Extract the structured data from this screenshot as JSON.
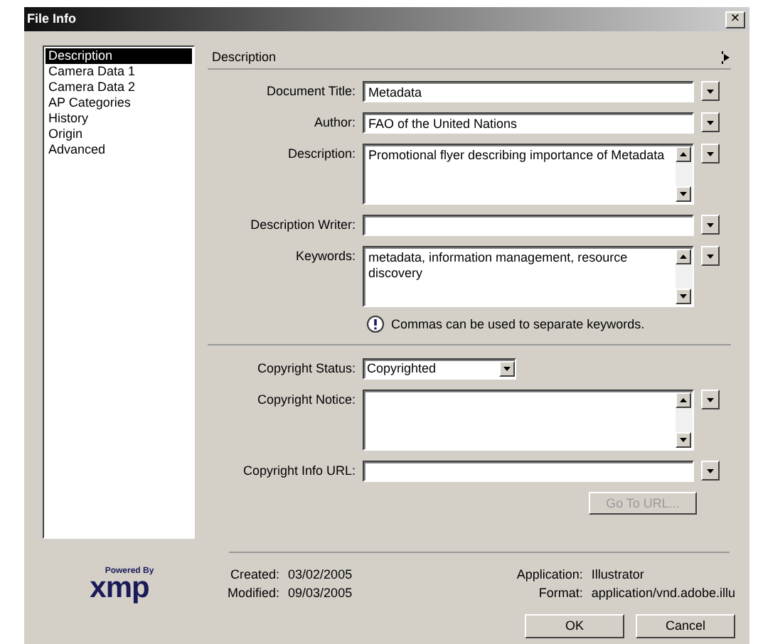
{
  "window": {
    "title": "File Info",
    "close": "×"
  },
  "sidebar": {
    "items": [
      {
        "label": "Description",
        "selected": true
      },
      {
        "label": "Camera Data 1",
        "selected": false
      },
      {
        "label": "Camera Data 2",
        "selected": false
      },
      {
        "label": "AP Categories",
        "selected": false
      },
      {
        "label": "History",
        "selected": false
      },
      {
        "label": "Origin",
        "selected": false
      },
      {
        "label": "Advanced",
        "selected": false
      }
    ]
  },
  "section_title": "Description",
  "fields": [
    {
      "kind": "text",
      "label": "Document Title:",
      "value": "Metadata",
      "menu": true
    },
    {
      "kind": "text",
      "label": "Author:",
      "value": "FAO of the United Nations",
      "menu": true
    },
    {
      "kind": "textarea",
      "label": "Description:",
      "value": "Promotional flyer describing importance of Metadata",
      "menu": true
    },
    {
      "kind": "text",
      "label": "Description Writer:",
      "menu": true
    },
    {
      "kind": "textarea",
      "label": "Keywords:",
      "value": "metadata, information management, resource discovery",
      "menu": true
    },
    {
      "kind": "note",
      "text": "Commas can be used to separate keywords."
    },
    {
      "kind": "rule"
    },
    {
      "kind": "select",
      "label": "Copyright Status:",
      "value": "Copyrighted",
      "menu": false
    },
    {
      "kind": "textarea",
      "label": "Copyright Notice:",
      "menu": true
    },
    {
      "kind": "text",
      "label": "Copyright Info URL:",
      "menu": true
    }
  ],
  "go_to_url": {
    "label": "Go To URL...",
    "disabled": true
  },
  "logo": {
    "caption": "Powered By",
    "wordmark": "xmp"
  },
  "info_left": [
    {
      "label": "Created:",
      "value": "03/02/2005"
    },
    {
      "label": "Modified:",
      "value": "09/03/2005"
    }
  ],
  "info_right": [
    {
      "label": "Application:",
      "value": "Illustrator"
    },
    {
      "label": "Format:",
      "value": "application/vnd.adobe.illu"
    }
  ],
  "buttons": [
    "OK",
    "Cancel"
  ]
}
